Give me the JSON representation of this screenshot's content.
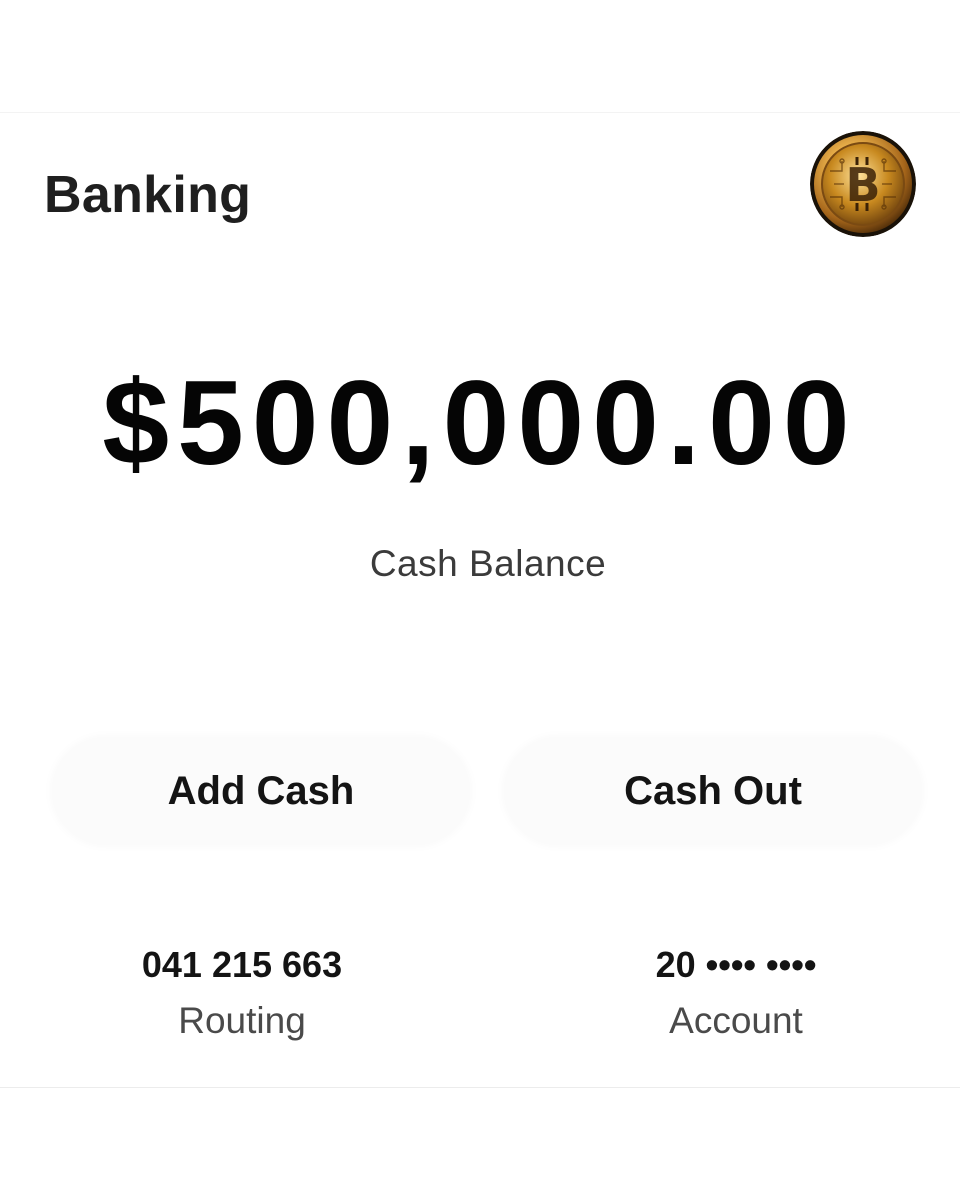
{
  "header": {
    "title": "Banking",
    "avatar_icon": "bitcoin-coin-icon"
  },
  "balance": {
    "amount": "$500,000.00",
    "label": "Cash Balance"
  },
  "actions": {
    "add_cash_label": "Add Cash",
    "cash_out_label": "Cash Out"
  },
  "account_info": {
    "routing_value": "041 215 663",
    "routing_label": "Routing",
    "account_value": "20 •••• ••••",
    "account_label": "Account"
  },
  "colors": {
    "background": "#ffffff",
    "text_primary": "#141414",
    "text_secondary": "#4a4a4a",
    "button_bg": "#fbfbfb",
    "coin_gold": "#c8912b"
  }
}
